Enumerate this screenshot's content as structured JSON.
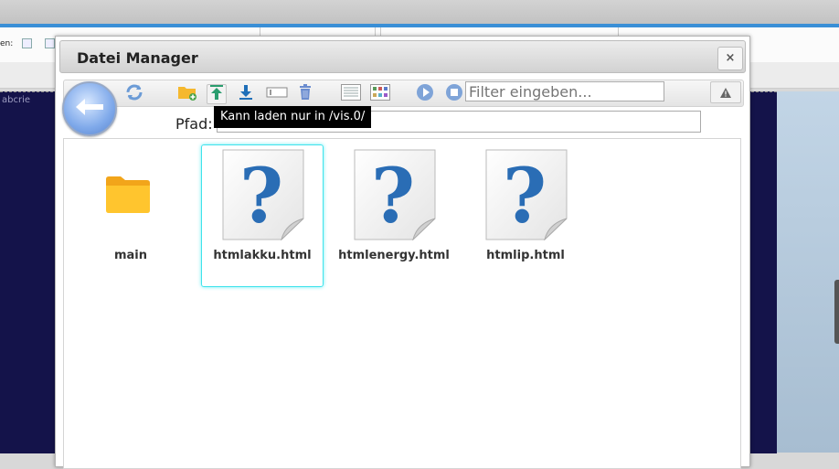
{
  "background": {
    "toolbar_label": "en:",
    "canvas_text": "abcrie"
  },
  "dialog": {
    "title": "Datei Manager",
    "close_label": "×",
    "toolbar": {
      "buttons": [
        {
          "name": "refresh-icon"
        },
        {
          "name": "new-folder-icon"
        },
        {
          "name": "upload-icon"
        },
        {
          "name": "download-icon"
        },
        {
          "name": "rename-icon"
        },
        {
          "name": "delete-icon"
        },
        {
          "name": "list-view-icon"
        },
        {
          "name": "grid-view-icon"
        },
        {
          "name": "play-icon"
        },
        {
          "name": "stop-icon"
        },
        {
          "name": "warning-icon"
        }
      ],
      "filter_placeholder": "Filter eingeben...",
      "colors": {
        "upload": "#2a9d6e",
        "download": "#1f6fb8",
        "delete": "#6a8ccf"
      }
    },
    "path_label": "Pfad:",
    "path_value": "/vis.0/",
    "tooltip": "Kann laden nur in /vis.0/",
    "files": [
      {
        "name": "main",
        "type": "folder",
        "selected": false
      },
      {
        "name": "htmlakku.html",
        "type": "unknown",
        "selected": true
      },
      {
        "name": "htmlenergy.html",
        "type": "unknown",
        "selected": false
      },
      {
        "name": "htmlip.html",
        "type": "unknown",
        "selected": false
      }
    ],
    "colors": {
      "accent_selected": "#3fe3ec",
      "folder": "#ffc52e",
      "question_mark": "#2a6db5"
    }
  }
}
